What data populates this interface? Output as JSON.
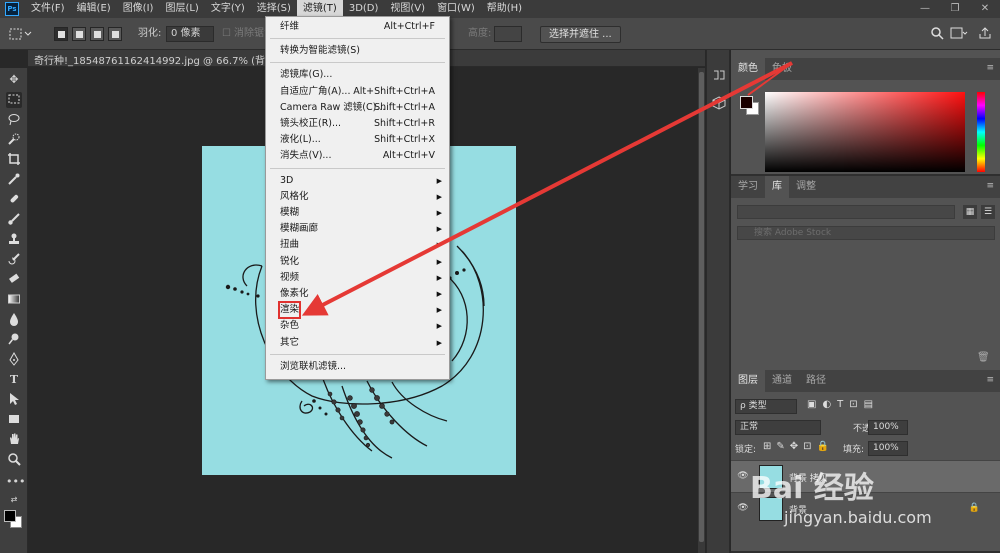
{
  "app": {
    "logo": "Ps"
  },
  "menubar": {
    "items": [
      "文件(F)",
      "编辑(E)",
      "图像(I)",
      "图层(L)",
      "文字(Y)",
      "选择(S)",
      "滤镜(T)",
      "3D(D)",
      "视图(V)",
      "窗口(W)",
      "帮助(H)"
    ],
    "active": "滤镜(T)"
  },
  "window_controls": {
    "minimize": "—",
    "restore": "❐",
    "close": "✕"
  },
  "options": {
    "feather_label": "羽化:",
    "feather_value": "0 像素",
    "anti_alias_label": "消除锯齿",
    "height_label": "高度:",
    "select_and_mask_label": "选择并遮住 ..."
  },
  "document": {
    "tab_label": "奇行种!_18548761162414992.jpg @ 66.7% (背景 拷贝, RGB/8) *",
    "close": "×",
    "canvas_color": "#96dde2"
  },
  "filter_menu": {
    "items": [
      {
        "label": "纤维",
        "shortcut": "Alt+Ctrl+F",
        "submenu": false
      },
      {
        "separator": true
      },
      {
        "label": "转换为智能滤镜(S)",
        "shortcut": "",
        "submenu": false
      },
      {
        "separator": true
      },
      {
        "label": "滤镜库(G)...",
        "shortcut": "",
        "submenu": false
      },
      {
        "label": "自适应广角(A)...",
        "shortcut": "Alt+Shift+Ctrl+A",
        "submenu": false
      },
      {
        "label": "Camera Raw 滤镜(C)...",
        "shortcut": "Shift+Ctrl+A",
        "submenu": false
      },
      {
        "label": "镜头校正(R)...",
        "shortcut": "Shift+Ctrl+R",
        "submenu": false
      },
      {
        "label": "液化(L)...",
        "shortcut": "Shift+Ctrl+X",
        "submenu": false
      },
      {
        "label": "消失点(V)...",
        "shortcut": "Alt+Ctrl+V",
        "submenu": false
      },
      {
        "separator": true
      },
      {
        "label": "3D",
        "shortcut": "",
        "submenu": true
      },
      {
        "label": "风格化",
        "shortcut": "",
        "submenu": true
      },
      {
        "label": "模糊",
        "shortcut": "",
        "submenu": true
      },
      {
        "label": "模糊画廊",
        "shortcut": "",
        "submenu": true
      },
      {
        "label": "扭曲",
        "shortcut": "",
        "submenu": true
      },
      {
        "label": "锐化",
        "shortcut": "",
        "submenu": true
      },
      {
        "label": "视频",
        "shortcut": "",
        "submenu": true
      },
      {
        "label": "像素化",
        "shortcut": "",
        "submenu": true
      },
      {
        "label": "渲染",
        "shortcut": "",
        "submenu": true,
        "highlighted": true
      },
      {
        "label": "杂色",
        "shortcut": "",
        "submenu": true
      },
      {
        "label": "其它",
        "shortcut": "",
        "submenu": true
      },
      {
        "separator": true
      },
      {
        "label": "浏览联机滤镜...",
        "shortcut": "",
        "submenu": false
      }
    ]
  },
  "color_panel": {
    "tabs": [
      "颜色",
      "色板"
    ],
    "fg_color": "#1a0000",
    "bg_color": "#ffffff",
    "spectrum_hue": "#ff1010"
  },
  "library_panel": {
    "tabs": [
      "学习",
      "库",
      "调整"
    ],
    "active": "库",
    "search_placeholder": "搜索 Adobe Stock"
  },
  "layers_panel": {
    "tabs": [
      "图层",
      "通道",
      "路径"
    ],
    "kind_filter": "ρ 类型",
    "blend_mode": "正常",
    "opacity_label": "不透明度:",
    "opacity_value": "100%",
    "lock_label": "锁定:",
    "fill_label": "填充:",
    "fill_value": "100%",
    "layers": [
      {
        "name": "背景 拷贝",
        "selected": true,
        "locked": false
      },
      {
        "name": "背景",
        "selected": false,
        "locked": true
      }
    ]
  },
  "annotation": {
    "color": "#e53935"
  },
  "watermark": {
    "logo": "Bai 经验",
    "url": "jingyan.baidu.com"
  }
}
